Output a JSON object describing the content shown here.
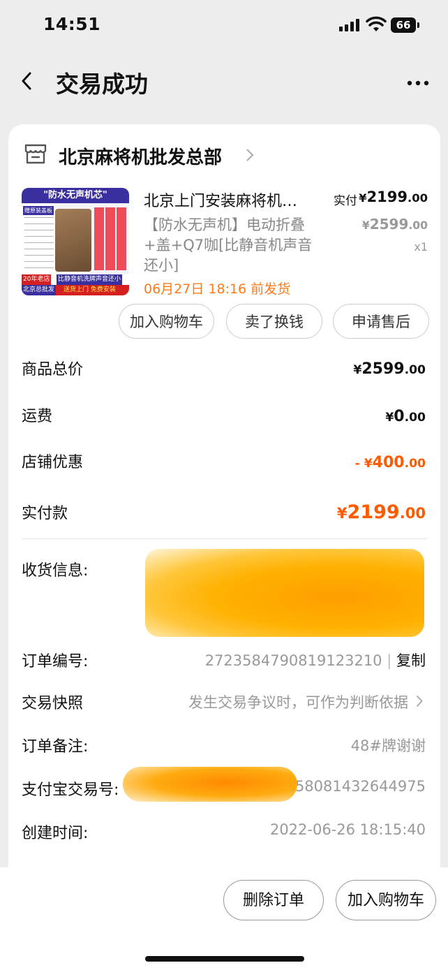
{
  "status_bar": {
    "time": "14:51",
    "battery": "66"
  },
  "nav": {
    "title": "交易成功"
  },
  "store": {
    "name": "北京麻将机批发总部"
  },
  "product": {
    "title": "北京上门安装麻将机…",
    "desc": "【防水无声机】电动折叠+盖+Q7咖[比静音机声音还小]",
    "ship_note": "06月27日 18:16 前发货",
    "paid_label": "实付",
    "paid_currency": "¥",
    "paid_int": "2199",
    "paid_dec": ".00",
    "orig_currency": "¥",
    "orig_int": "2599",
    "orig_dec": ".00",
    "qty": "x1",
    "image_text": {
      "header": "\"防水无声机芯\"",
      "tag": "赠原装盖板",
      "footer1_left": "20年老店",
      "footer1_right": "比静音机洗牌声音还小",
      "footer2_left": "北京总批发",
      "footer2_right": "送货上门 免费安装"
    }
  },
  "actions": {
    "add_cart": "加入购物车",
    "sell": "卖了换钱",
    "after_sale": "申请售后"
  },
  "summary": {
    "total_label": "商品总价",
    "total_currency": "¥",
    "total_int": "2599",
    "total_dec": ".00",
    "shipping_label": "运费",
    "shipping_currency": "¥",
    "shipping_int": "0",
    "shipping_dec": ".00",
    "discount_label": "店铺优惠",
    "discount_prefix": "- ¥",
    "discount_int": "400",
    "discount_dec": ".00",
    "paid_label": "实付款",
    "paid_currency": "¥",
    "paid_int": "2199",
    "paid_dec": ".00"
  },
  "info": {
    "address_label": "收货信息:",
    "order_no_label": "订单编号:",
    "order_no": "2723584790819123210",
    "order_no_sep": "|",
    "copy": "复制",
    "snapshot_label": "交易快照",
    "snapshot_value": "发生交易争议时，可作为判断依据",
    "remark_label": "订单备注:",
    "remark_value": "48#牌谢谢",
    "alipay_label": "支付宝交易号:",
    "alipay_value": "01158081432644975",
    "created_label": "创建时间:",
    "created_value": "2022-06-26 18:15:40"
  },
  "bottom": {
    "delete": "删除订单",
    "add_cart": "加入购物车"
  },
  "colors": {
    "accent": "#ff5a00",
    "ship_note": "#ff7a1a"
  }
}
